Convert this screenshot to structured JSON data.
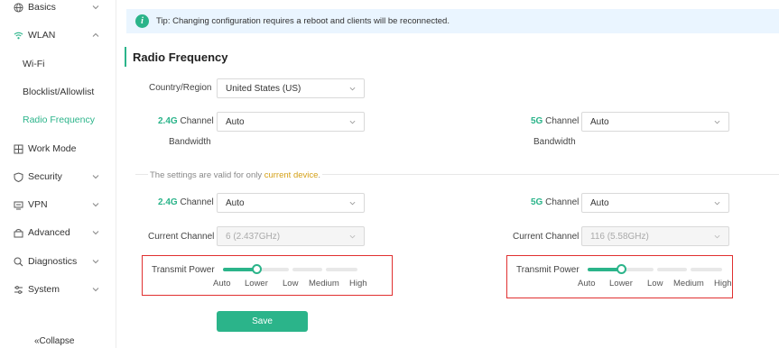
{
  "sidebar": {
    "items": [
      {
        "label": "Basics",
        "icon": "globe-icon"
      },
      {
        "label": "WLAN",
        "icon": "wifi-icon"
      },
      {
        "label": "Wi-Fi"
      },
      {
        "label": "Blocklist/Allowlist"
      },
      {
        "label": "Radio Frequency"
      },
      {
        "label": "Work Mode",
        "icon": "grid-icon"
      },
      {
        "label": "Security",
        "icon": "shield-icon"
      },
      {
        "label": "VPN",
        "icon": "vpn-icon"
      },
      {
        "label": "Advanced",
        "icon": "advanced-icon"
      },
      {
        "label": "Diagnostics",
        "icon": "diagnostics-icon"
      },
      {
        "label": "System",
        "icon": "settings-icon"
      }
    ],
    "collapse_label": "«Collapse"
  },
  "tip": {
    "text": "Tip: Changing configuration requires a reboot and clients will be reconnected."
  },
  "section": {
    "title": "Radio Frequency"
  },
  "form": {
    "country_label": "Country/Region",
    "country_value": "United States (US)",
    "bw_24_band": "2.4G",
    "bw_24_label": " Channel",
    "bw_24_label2": "Bandwidth",
    "bw_24_value": "Auto",
    "bw_5_band": "5G",
    "bw_5_label": " Channel",
    "bw_5_label2": "Bandwidth",
    "bw_5_value": "Auto",
    "note_prefix": "The settings are valid for only ",
    "note_highlight": "current device",
    "note_suffix": ".",
    "ch_24_band": "2.4G",
    "ch_24_label": " Channel",
    "ch_24_value": "Auto",
    "ch_5_band": "5G",
    "ch_5_label": " Channel",
    "ch_5_value": "Auto",
    "cur_24_label": "Current Channel",
    "cur_24_value": "6  (2.437GHz)",
    "cur_5_label": "Current Channel",
    "cur_5_value": "116  (5.58GHz)",
    "tx_24_label": "Transmit Power",
    "tx_5_label": "Transmit Power",
    "tx_levels": [
      "Auto",
      "Lower",
      "Low",
      "Medium",
      "High"
    ],
    "tx_24_selected": "Lower",
    "tx_5_selected": "Lower",
    "save_label": "Save"
  },
  "colors": {
    "accent": "#2bb48a",
    "highlight_box": "#e03030",
    "note_highlight": "#d4a017"
  }
}
